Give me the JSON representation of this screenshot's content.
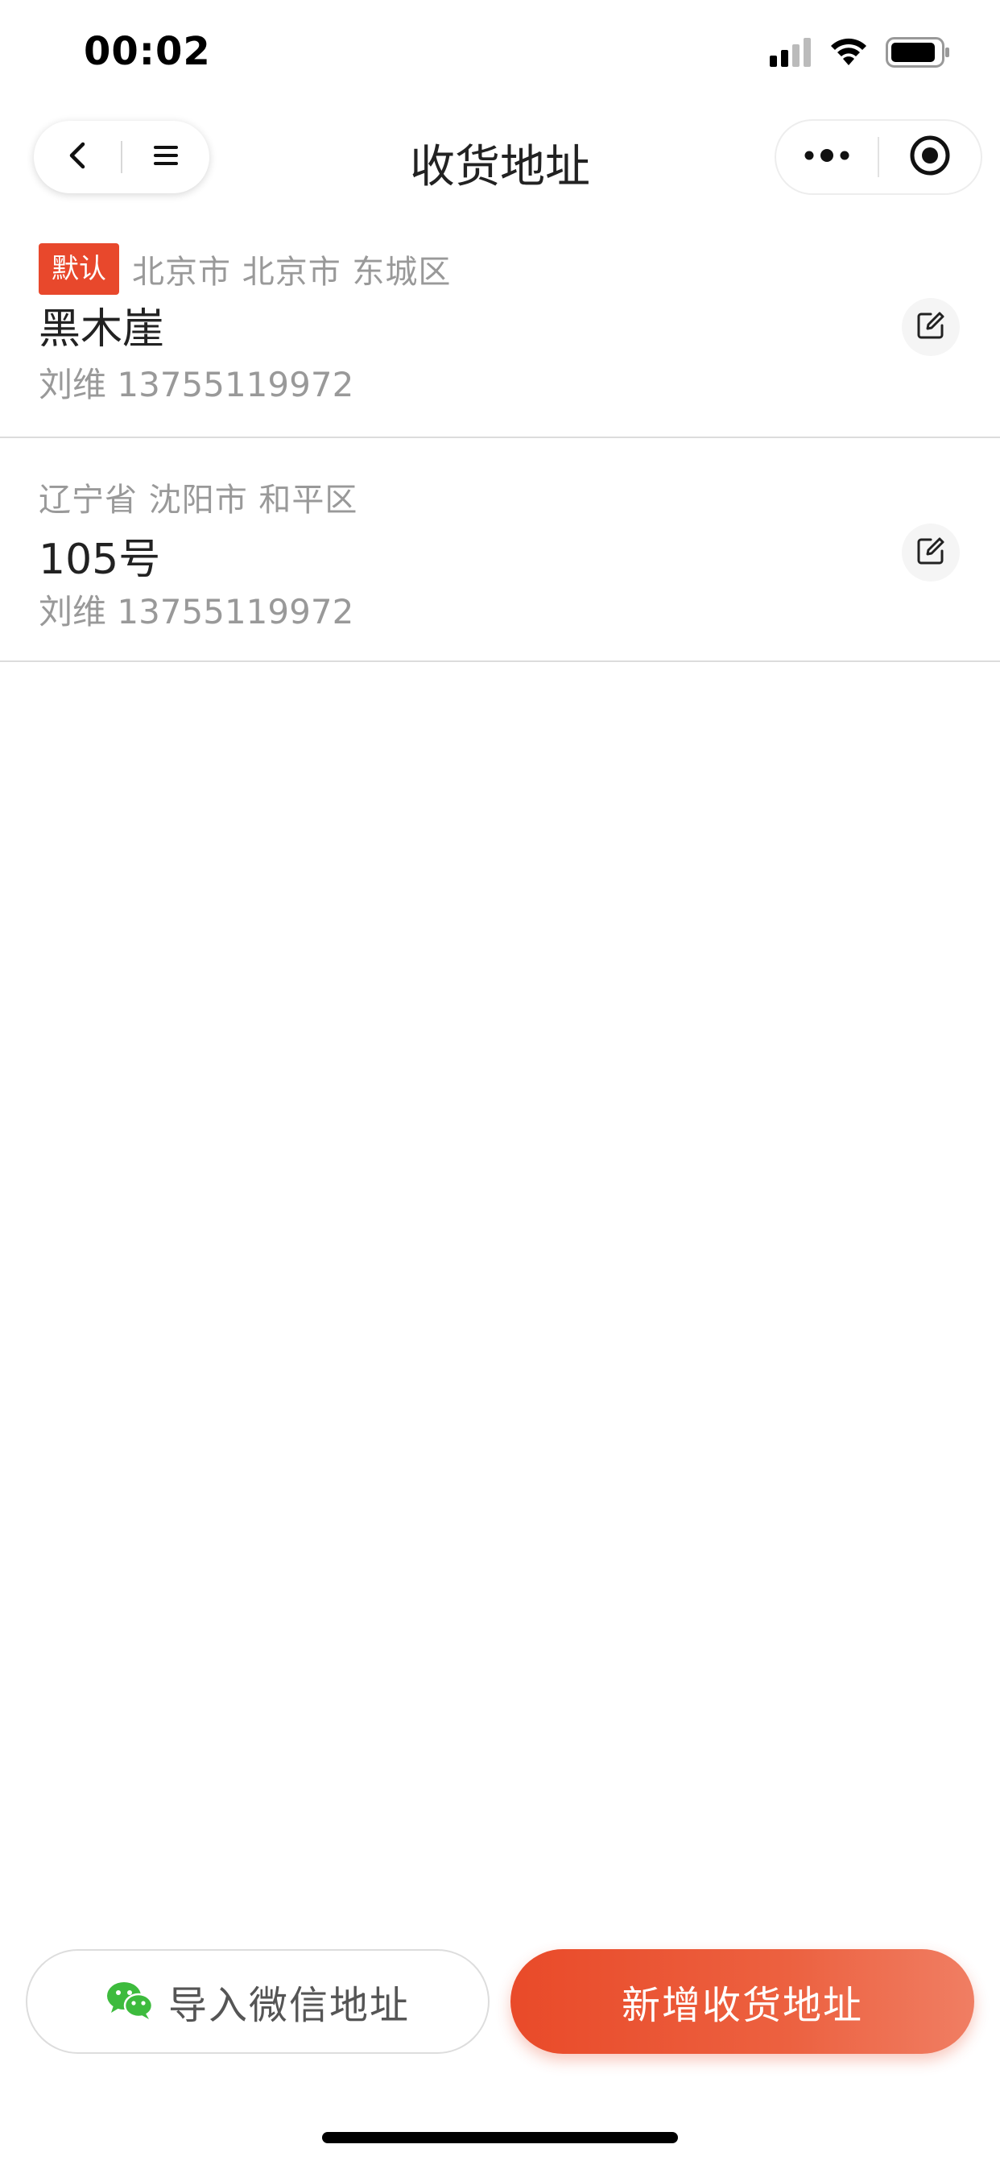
{
  "status_bar": {
    "time": "00:02"
  },
  "nav": {
    "title": "收货地址"
  },
  "addresses": [
    {
      "is_default": true,
      "default_label": "默认",
      "region": "北京市 北京市 东城区",
      "detail": "黑木崖",
      "contact": "刘维 13755119972"
    },
    {
      "is_default": false,
      "region": "辽宁省 沈阳市 和平区",
      "detail": "105号",
      "contact": "刘维 13755119972"
    }
  ],
  "actions": {
    "import_label": "导入微信地址",
    "add_label": "新增收货地址"
  },
  "colors": {
    "accent": "#e8482c",
    "wechat_green": "#3dbb3d",
    "secondary_text": "#999999"
  },
  "icons": {
    "back": "chevron-left-icon",
    "menu": "menu-icon",
    "more": "more-dots-icon",
    "close_target": "target-icon",
    "edit": "edit-icon",
    "wechat": "wechat-icon"
  }
}
